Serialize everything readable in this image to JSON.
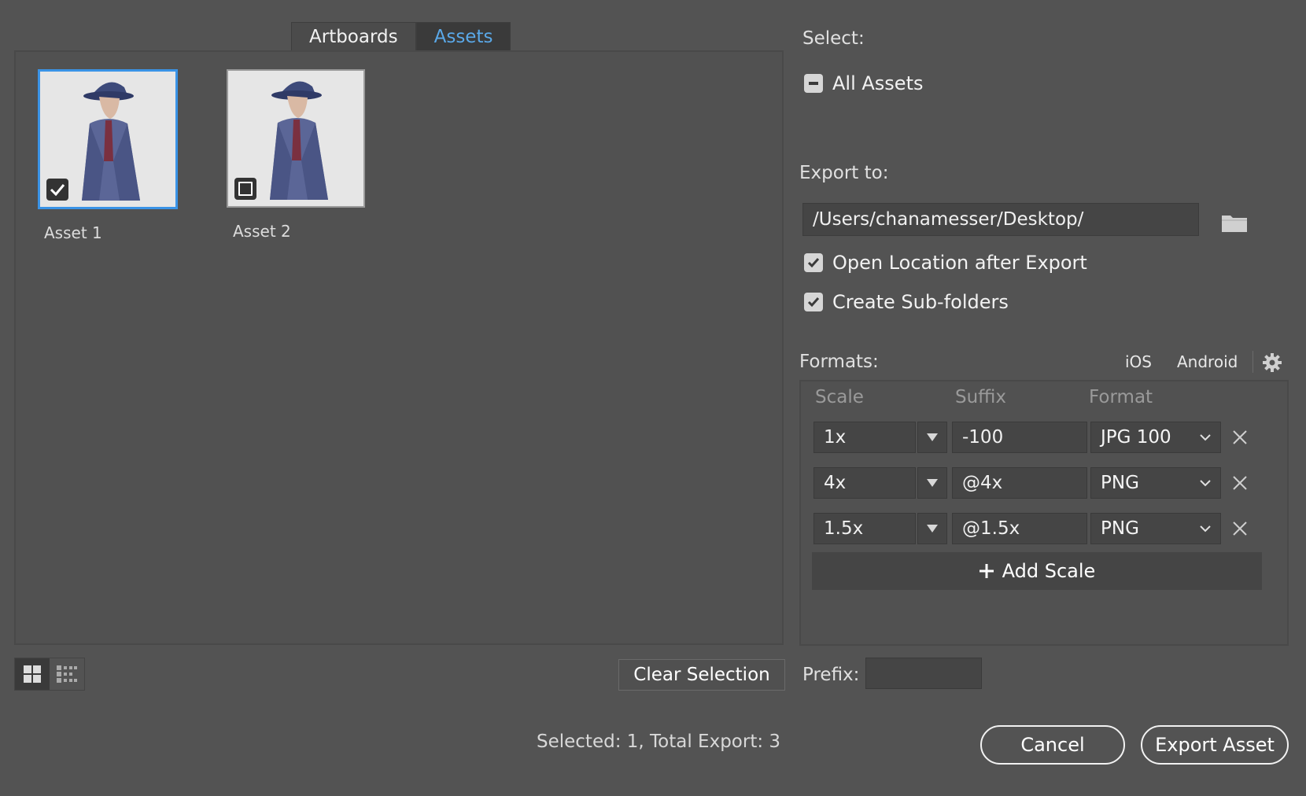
{
  "tabs": [
    {
      "label": "Artboards",
      "active": false
    },
    {
      "label": "Assets",
      "active": true
    }
  ],
  "assets": [
    {
      "label": "Asset 1",
      "checked": true
    },
    {
      "label": "Asset 2",
      "checked": false
    }
  ],
  "view_toggle": {
    "grid_icon": "grid-view-icon",
    "list_icon": "list-view-icon"
  },
  "clear_selection_label": "Clear Selection",
  "status_text": "Selected: 1, Total Export: 3",
  "select": {
    "heading": "Select:",
    "all_assets_label": "All Assets",
    "all_assets_state": "indeterminate"
  },
  "export_to": {
    "heading": "Export to:",
    "path": "/Users/chanamesser/Desktop/",
    "folder_icon": "folder-icon",
    "open_location_label": "Open Location after Export",
    "open_location_checked": true,
    "subfolders_label": "Create Sub-folders",
    "subfolders_checked": true
  },
  "formats": {
    "heading": "Formats:",
    "ios_label": "iOS",
    "android_label": "Android",
    "settings_icon": "gear-icon",
    "columns": {
      "scale": "Scale",
      "suffix": "Suffix",
      "format": "Format"
    },
    "rows": [
      {
        "scale": "1x",
        "suffix": "-100",
        "format": "JPG 100"
      },
      {
        "scale": "4x",
        "suffix": "@4x",
        "format": "PNG"
      },
      {
        "scale": "1.5x",
        "suffix": "@1.5x",
        "format": "PNG"
      }
    ],
    "add_scale_label": "Add Scale"
  },
  "prefix_label": "Prefix:",
  "prefix_value": "",
  "cancel_label": "Cancel",
  "export_label": "Export Asset",
  "colors": {
    "background": "#535353",
    "accent": "#3a93e6",
    "tab_active_text": "#5aa8e8"
  }
}
